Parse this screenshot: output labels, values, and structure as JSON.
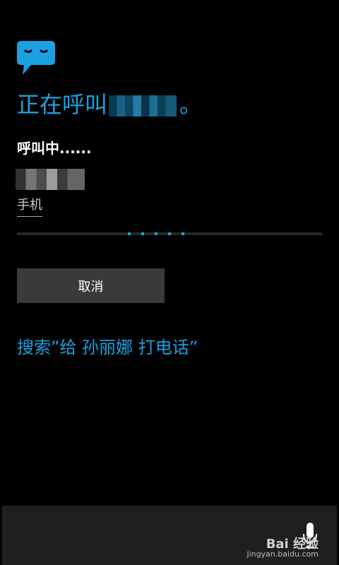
{
  "app": {
    "icon": "speech-bubble-icon"
  },
  "call": {
    "title_prefix": "正在呼叫",
    "title_suffix": "。",
    "status": "呼叫中......",
    "phone_type": "手机",
    "progress_dots": 5
  },
  "actions": {
    "cancel_label": "取消",
    "search_text": "搜索”给 孙丽娜 打电话”"
  },
  "bottom_bar": {
    "icon": "microphone-icon",
    "watermark_brand": "Bai 经验",
    "watermark_url": "jingyan.baidu.com"
  },
  "colors": {
    "accent": "#1ba1e2",
    "background": "#000000",
    "button": "#3a3a3a",
    "bottom_bar": "#1f1f1f"
  }
}
